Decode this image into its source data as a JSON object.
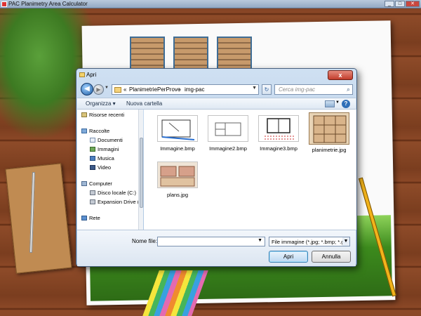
{
  "app": {
    "title": "PAC Planimetry Area Calculator"
  },
  "dialog": {
    "title": "Apri",
    "close_label": "x",
    "address": {
      "segments": [
        "PlanimetriePerProve",
        "img-pac"
      ],
      "prefix": "«",
      "separator": "›"
    },
    "search_placeholder": "Cerca img-pac",
    "toolbar": {
      "organize": "Organizza ▾",
      "new_folder": "Nuova cartella",
      "help": "?"
    },
    "nav": {
      "items": [
        {
          "label": "Risorse recenti",
          "icon": "recent-places-icon"
        },
        {
          "label": "Raccolte",
          "icon": "libraries-icon"
        },
        {
          "label": "Documenti",
          "icon": "documents-icon"
        },
        {
          "label": "Immagini",
          "icon": "pictures-icon"
        },
        {
          "label": "Musica",
          "icon": "music-icon"
        },
        {
          "label": "Video",
          "icon": "video-icon"
        },
        {
          "label": "Computer",
          "icon": "computer-icon"
        },
        {
          "label": "Disco locale (C:)",
          "icon": "drive-icon"
        },
        {
          "label": "Expansion Drive (",
          "icon": "drive-icon"
        },
        {
          "label": "Rete",
          "icon": "network-icon"
        }
      ]
    },
    "files": [
      {
        "name": "Immagine.bmp"
      },
      {
        "name": "Immagine2.bmp"
      },
      {
        "name": "Immagine3.bmp"
      },
      {
        "name": "planimetrie.jpg"
      },
      {
        "name": "plans.jpg"
      }
    ],
    "filename_label": "Nome file:",
    "filename_value": "",
    "filter_value": "File immagine (*.jpg; *.bmp; *.g",
    "open_button": "Apri",
    "cancel_button": "Annulla"
  },
  "colors": {
    "accent": "#3c7fb1",
    "title_bar": "#a8c3e0",
    "wood": "#7a3d1f"
  }
}
